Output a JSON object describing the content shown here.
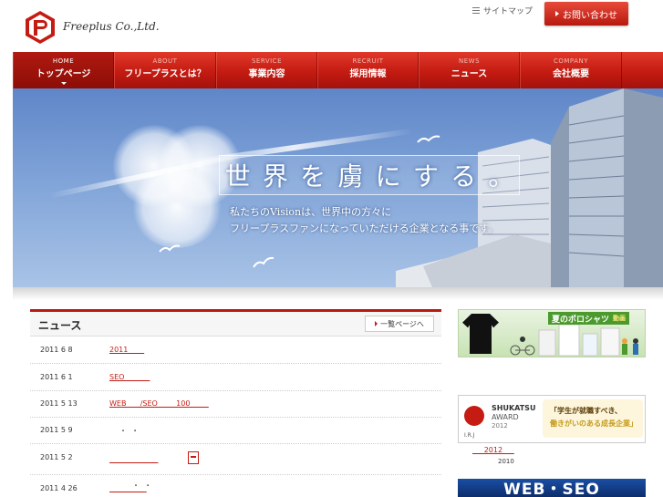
{
  "header": {
    "company_name": "Freeplus Co.,Ltd.",
    "sitemap_label": "サイトマップ",
    "contact_label": "お問い合わせ"
  },
  "nav": [
    {
      "en": "HOME",
      "jp": "トップページ",
      "active": true
    },
    {
      "en": "ABOUT",
      "jp": "フリープラスとは？",
      "active": false
    },
    {
      "en": "SERVICE",
      "jp": "事業内容",
      "active": false
    },
    {
      "en": "RECRUIT",
      "jp": "採用情報",
      "active": false
    },
    {
      "en": "NEWS",
      "jp": "ニュース",
      "active": false
    },
    {
      "en": "COMPANY",
      "jp": "会社概要",
      "active": false
    }
  ],
  "hero": {
    "slogan_chars": [
      "世",
      "界",
      "を",
      "虜",
      "に",
      "す",
      "る",
      "。"
    ],
    "vision_line1": "私たちのVisionは、世界中の方々に",
    "vision_line2": "フリープラスファンになっていただける企業となる事です。"
  },
  "news": {
    "title": "ニュース",
    "more_label": "一覧ページへ",
    "items": [
      {
        "date": "2011 6 8",
        "link": "2011       ",
        "extra": ""
      },
      {
        "date": "2011 6 1",
        "link": "SEO           ",
        "extra": ""
      },
      {
        "date": "2011 5 13",
        "link": "WEB      /SEO        100        ",
        "extra": ""
      },
      {
        "date": "2011 5 9",
        "link": "",
        "extra": "・  ・"
      },
      {
        "date": "2011 5 2",
        "link": "                     ",
        "extra": "",
        "pdf": true
      },
      {
        "date": "2011 4 26",
        "link": "                ",
        "extra": "・  ・"
      }
    ]
  },
  "sidebar": {
    "banner1_title": "夏のポロシャツ",
    "banner1_sub": "動画",
    "award_line1": "SHUKATSU",
    "award_line2": "AWARD",
    "award_line3": "2012",
    "award_ir": "I.R.J",
    "award_quote1": "「学生が就職すべき、",
    "award_quote2": "働きがいのある成長企業」",
    "link_label": "     2012     ",
    "year_text": "2010",
    "banner3_text": "WEB・SEO"
  },
  "colors": {
    "brand_red": "#c41b12",
    "nav_dark": "#8c0d07"
  }
}
